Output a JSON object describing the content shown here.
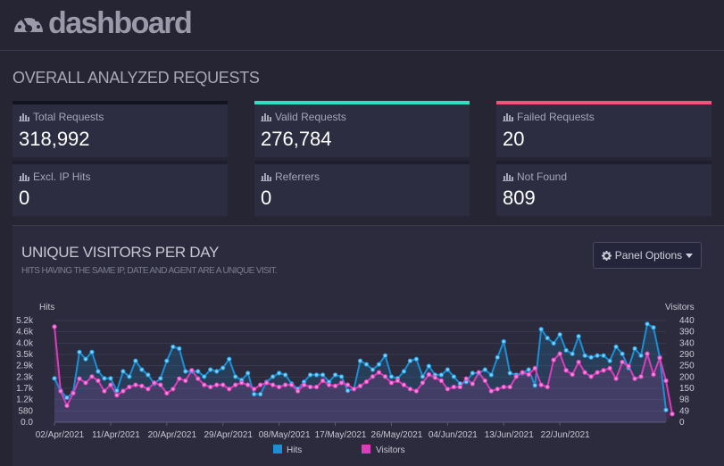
{
  "header": {
    "brand": "dashboard",
    "logo_icon": "gauge-icon"
  },
  "overall": {
    "title": "OVERALL ANALYZED REQUESTS"
  },
  "cards": [
    {
      "name": "total-requests",
      "label": "Total Requests",
      "value": "318,992",
      "accent": "#141420"
    },
    {
      "name": "valid-requests",
      "label": "Valid Requests",
      "value": "276,784",
      "accent": "#2fe0c3"
    },
    {
      "name": "failed-requests",
      "label": "Failed Requests",
      "value": "20",
      "accent": "#f0547a"
    },
    {
      "name": "excl-ip-hits",
      "label": "Excl. IP Hits",
      "value": "0",
      "accent": "#1e1e2e"
    },
    {
      "name": "referrers",
      "label": "Referrers",
      "value": "0",
      "accent": "#1e1e2e"
    },
    {
      "name": "not-found",
      "label": "Not Found",
      "value": "809",
      "accent": "#1e1e2e"
    }
  ],
  "panel": {
    "title": "UNIQUE VISITORS PER DAY",
    "subtitle": "HITS HAVING THE SAME IP, DATE AND AGENT ARE A UNIQUE VISIT.",
    "options_label": "Panel Options",
    "options_icon": "gear-icon",
    "options_caret": "caret-down-icon"
  },
  "chart_data": {
    "type": "line",
    "ylabel_left": "Hits",
    "ylabel_right": "Visitors",
    "y_left_ticks": [
      "0.0",
      "580",
      "1.2k",
      "1.7k",
      "2.3k",
      "2.9k",
      "3.5k",
      "4.0k",
      "4.6k",
      "5.2k"
    ],
    "y_left_range": [
      0,
      5800
    ],
    "y_right_ticks": [
      "0",
      "49",
      "98",
      "150",
      "200",
      "250",
      "290",
      "340",
      "390",
      "440"
    ],
    "y_right_range": [
      0,
      490
    ],
    "x_tick_labels": [
      "02/Apr/2021",
      "11/Apr/2021",
      "20/Apr/2021",
      "29/Apr/2021",
      "08/May/2021",
      "17/May/2021",
      "26/May/2021",
      "04/Jun/2021",
      "13/Jun/2021",
      "22/Jun/2021"
    ],
    "x_tick_index": [
      0,
      9,
      18,
      27,
      36,
      45,
      54,
      63,
      72,
      81
    ],
    "colors": {
      "hits": "#1a8fd4",
      "visitors": "#d93db9",
      "hits_fill": "rgba(26,143,212,0.18)",
      "visitors_fill": "rgba(217,61,185,0.14)"
    },
    "series": [
      {
        "name": "Hits",
        "values": [
          2500,
          1800,
          1400,
          1700,
          4000,
          3600,
          4000,
          2900,
          2500,
          2500,
          1800,
          2900,
          2600,
          3500,
          3000,
          2700,
          2200,
          2500,
          3500,
          4300,
          4200,
          2900,
          2900,
          2900,
          2600,
          3000,
          2900,
          3100,
          3600,
          2600,
          2400,
          2800,
          1600,
          1600,
          2300,
          2600,
          2800,
          2700,
          2200,
          1900,
          2300,
          2700,
          2700,
          2700,
          2300,
          2700,
          2600,
          1800,
          1900,
          3500,
          3300,
          3000,
          3300,
          3800,
          2600,
          2500,
          2900,
          3500,
          3600,
          2600,
          3200,
          2700,
          2700,
          3000,
          2600,
          2200,
          2300,
          2800,
          2800,
          3000,
          2700,
          3700,
          4600,
          2800,
          2700,
          2800,
          3000,
          2100,
          5300,
          4800,
          4500,
          5000,
          4100,
          3900,
          4900,
          3800,
          3700,
          3800,
          3800,
          3500,
          4300,
          3900,
          3100,
          4200,
          3800,
          5600,
          5400,
          3700,
          700
        ]
      },
      {
        "name": "Visitors",
        "values": [
          460,
          150,
          80,
          140,
          210,
          190,
          220,
          200,
          150,
          180,
          130,
          150,
          170,
          180,
          175,
          160,
          190,
          180,
          140,
          160,
          210,
          200,
          250,
          210,
          180,
          170,
          180,
          180,
          160,
          180,
          190,
          180,
          160,
          180,
          190,
          180,
          170,
          180,
          180,
          150,
          180,
          170,
          170,
          200,
          180,
          175,
          190,
          180,
          160,
          175,
          195,
          220,
          240,
          220,
          190,
          200,
          180,
          160,
          150,
          190,
          230,
          215,
          200,
          160,
          170,
          170,
          210,
          185,
          240,
          200,
          150,
          160,
          170,
          170,
          220,
          240,
          230,
          260,
          180,
          170,
          300,
          330,
          250,
          230,
          290,
          240,
          220,
          240,
          250,
          260,
          210,
          290,
          270,
          210,
          220,
          330,
          230,
          310,
          200,
          40
        ]
      }
    ]
  }
}
